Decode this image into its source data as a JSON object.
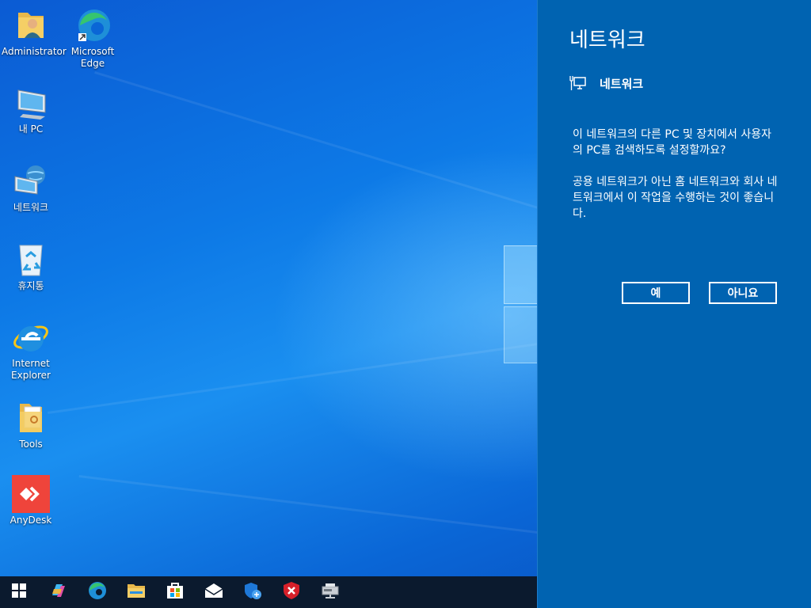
{
  "desktop": {
    "icons": [
      {
        "label": "Administrator",
        "icon": "user-folder-icon"
      },
      {
        "label": "Microsoft Edge",
        "icon": "edge-icon"
      },
      {
        "label": "내 PC",
        "icon": "computer-icon"
      },
      {
        "label": "네트워크",
        "icon": "network-icon"
      },
      {
        "label": "휴지통",
        "icon": "recycle-bin-icon"
      },
      {
        "label": "Internet Explorer",
        "icon": "internet-explorer-icon"
      },
      {
        "label": "Tools",
        "icon": "tools-folder-icon"
      },
      {
        "label": "AnyDesk",
        "icon": "anydesk-icon"
      }
    ]
  },
  "panel": {
    "title": "네트워크",
    "network_name": "네트워크",
    "question": "이 네트워크의 다른 PC 및 장치에서 사용자의 PC를 검색하도록 설정할까요?",
    "advice": "공용 네트워크가 아닌 홈 네트워크와 회사 네트워크에서 이 작업을 수행하는 것이 좋습니다.",
    "yes_label": "예",
    "no_label": "아니요",
    "background_color": "#0063b1"
  },
  "taskbar": {
    "items": [
      "start-icon",
      "copilot-icon",
      "edge-icon",
      "file-explorer-icon",
      "store-icon",
      "mail-icon",
      "security-center-icon",
      "antivirus-icon",
      "network-drive-icon"
    ]
  }
}
